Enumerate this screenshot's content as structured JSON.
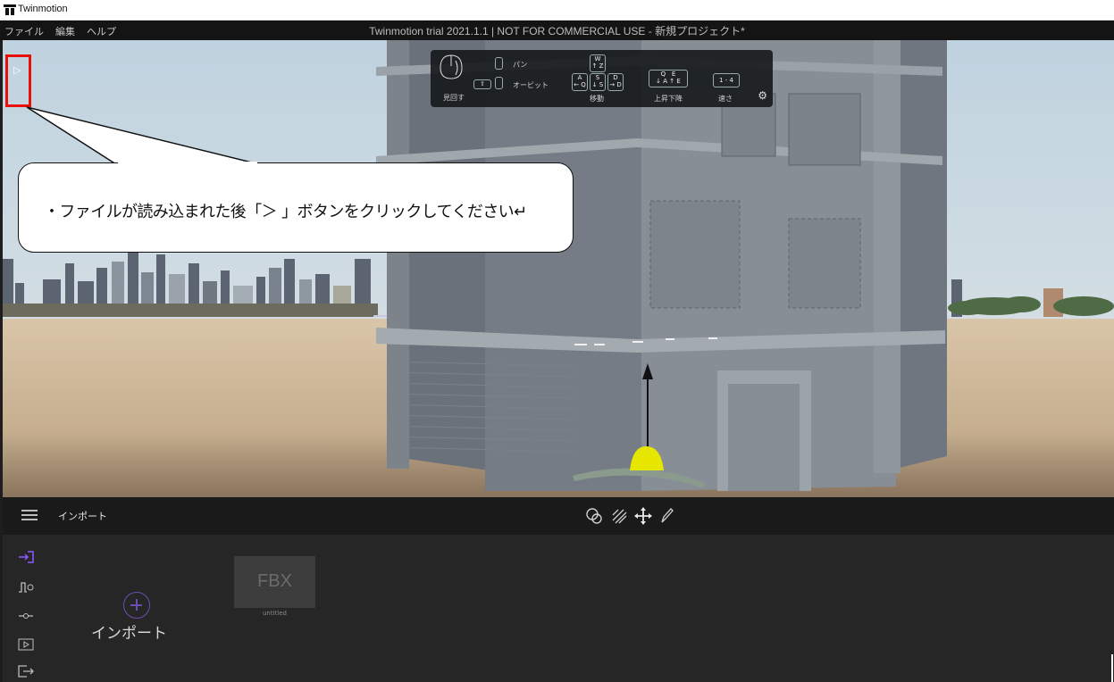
{
  "titlebar": {
    "app_name": "Twinmotion",
    "icon": "twinmotion-logo-icon"
  },
  "menubar": {
    "items": [
      "ファイル",
      "編集",
      "ヘルプ"
    ],
    "window_title": "Twinmotion trial 2021.1.1 | NOT FOR COMMERCIAL USE - 新規プロジェクト*"
  },
  "navigation_hint": {
    "look": "見回す",
    "pan": "パン",
    "orbit": "オービット",
    "move": "移動",
    "up_down": "上昇下降",
    "speed": "速さ",
    "keys": {
      "w": "W",
      "w_sub": "↑ Z",
      "a": "A",
      "a_sub": "← Q",
      "s": "S",
      "s_sub": "↓ S",
      "d": "D",
      "d_sub": "→ D",
      "q": "Q",
      "q_sub": "↓ A",
      "e": "E",
      "e_sub": "↑ E",
      "speed_keys": "1 - 4"
    },
    "settings_icon": "gear-icon"
  },
  "sidebar_toggle": {
    "glyph": "▷"
  },
  "callout": {
    "text": "・ファイルが読み込まれた後「＞ 」ボタンをクリックしてください↵"
  },
  "toolbar": {
    "menu_icon": "hamburger-icon",
    "section_title": "インポート",
    "tools": [
      "select-icon",
      "paint-icon",
      "move-gizmo-icon",
      "pencil-icon"
    ]
  },
  "library": {
    "nav_icons": [
      "import-icon",
      "graph-icon",
      "slider-icon",
      "media-icon",
      "export-icon"
    ],
    "import_button_label": "インポート",
    "items": [
      {
        "thumb_label": "FBX",
        "name": "untitled"
      }
    ]
  },
  "colors": {
    "accent": "#8a5cff",
    "highlight_box": "#e8110a",
    "gizmo_yellow": "#e6e600"
  }
}
